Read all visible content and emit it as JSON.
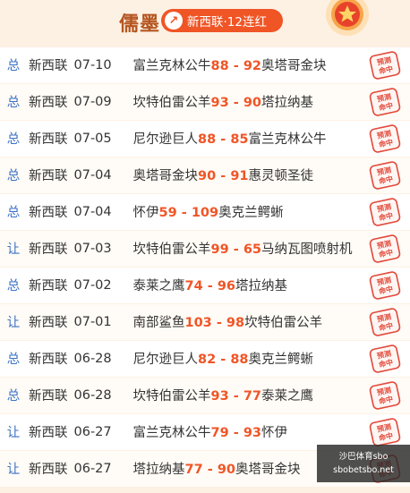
{
  "header": {
    "name": "儒墨",
    "badge_icon": "↗",
    "badge_text": "新西联·12连红"
  },
  "rows": [
    {
      "kind": "总",
      "league": "新西联",
      "date": "07-10",
      "home": "富兰克林公牛",
      "home_score": "88",
      "sep": " - ",
      "away_score": "92",
      "away": "奥塔哥金块",
      "stamp": "预测命中"
    },
    {
      "kind": "总",
      "league": "新西联",
      "date": "07-09",
      "home": "坎特伯雷公羊",
      "home_score": "93",
      "sep": " - ",
      "away_score": "90",
      "away": "塔拉纳基",
      "stamp": "预测命中"
    },
    {
      "kind": "总",
      "league": "新西联",
      "date": "07-05",
      "home": "尼尔逊巨人",
      "home_score": "88",
      "sep": " - ",
      "away_score": "85",
      "away": "富兰克林公牛",
      "stamp": "预测命中"
    },
    {
      "kind": "总",
      "league": "新西联",
      "date": "07-04",
      "home": "奥塔哥金块",
      "home_score": "90",
      "sep": " - ",
      "away_score": "91",
      "away": "惠灵顿圣徒",
      "stamp": "预测命中"
    },
    {
      "kind": "总",
      "league": "新西联",
      "date": "07-04",
      "home": "怀伊",
      "home_score": "59",
      "sep": " - ",
      "away_score": "109",
      "away": "奥克兰鳄蜥",
      "stamp": "预测命中"
    },
    {
      "kind": "让",
      "league": "新西联",
      "date": "07-03",
      "home": "坎特伯雷公羊",
      "home_score": "99",
      "sep": " - ",
      "away_score": "65",
      "away": "马纳瓦图喷射机",
      "stamp": "预测命中"
    },
    {
      "kind": "总",
      "league": "新西联",
      "date": "07-02",
      "home": "泰莱之鹰",
      "home_score": "74",
      "sep": " - ",
      "away_score": "96",
      "away": "塔拉纳基",
      "stamp": "预测命中"
    },
    {
      "kind": "让",
      "league": "新西联",
      "date": "07-01",
      "home": "南部鲨鱼",
      "home_score": "103",
      "sep": " - ",
      "away_score": "98",
      "away": "坎特伯雷公羊",
      "stamp": "预测命中"
    },
    {
      "kind": "总",
      "league": "新西联",
      "date": "06-28",
      "home": "尼尔逊巨人",
      "home_score": "82",
      "sep": " - ",
      "away_score": "88",
      "away": "奥克兰鳄蜥",
      "stamp": "预测命中"
    },
    {
      "kind": "总",
      "league": "新西联",
      "date": "06-28",
      "home": "坎特伯雷公羊",
      "home_score": "93",
      "sep": " - ",
      "away_score": "77",
      "away": "泰莱之鹰",
      "stamp": "预测命中"
    },
    {
      "kind": "让",
      "league": "新西联",
      "date": "06-27",
      "home": "富兰克林公牛",
      "home_score": "79",
      "sep": " - ",
      "away_score": "93",
      "away": "怀伊",
      "stamp": "预测命中"
    },
    {
      "kind": "让",
      "league": "新西联",
      "date": "06-27",
      "home": "塔拉纳基",
      "home_score": "77",
      "sep": " - ",
      "away_score": "90",
      "away": "奥塔哥金块",
      "stamp": "预测命中"
    }
  ],
  "watermark": {
    "line1": "沙巴体育sbo",
    "line2": "sbobetsbo.net"
  },
  "colors": {
    "accent": "#f05526",
    "kind_text": "#3b72c4",
    "title": "#b4551f",
    "background": "#fdf1e4"
  }
}
